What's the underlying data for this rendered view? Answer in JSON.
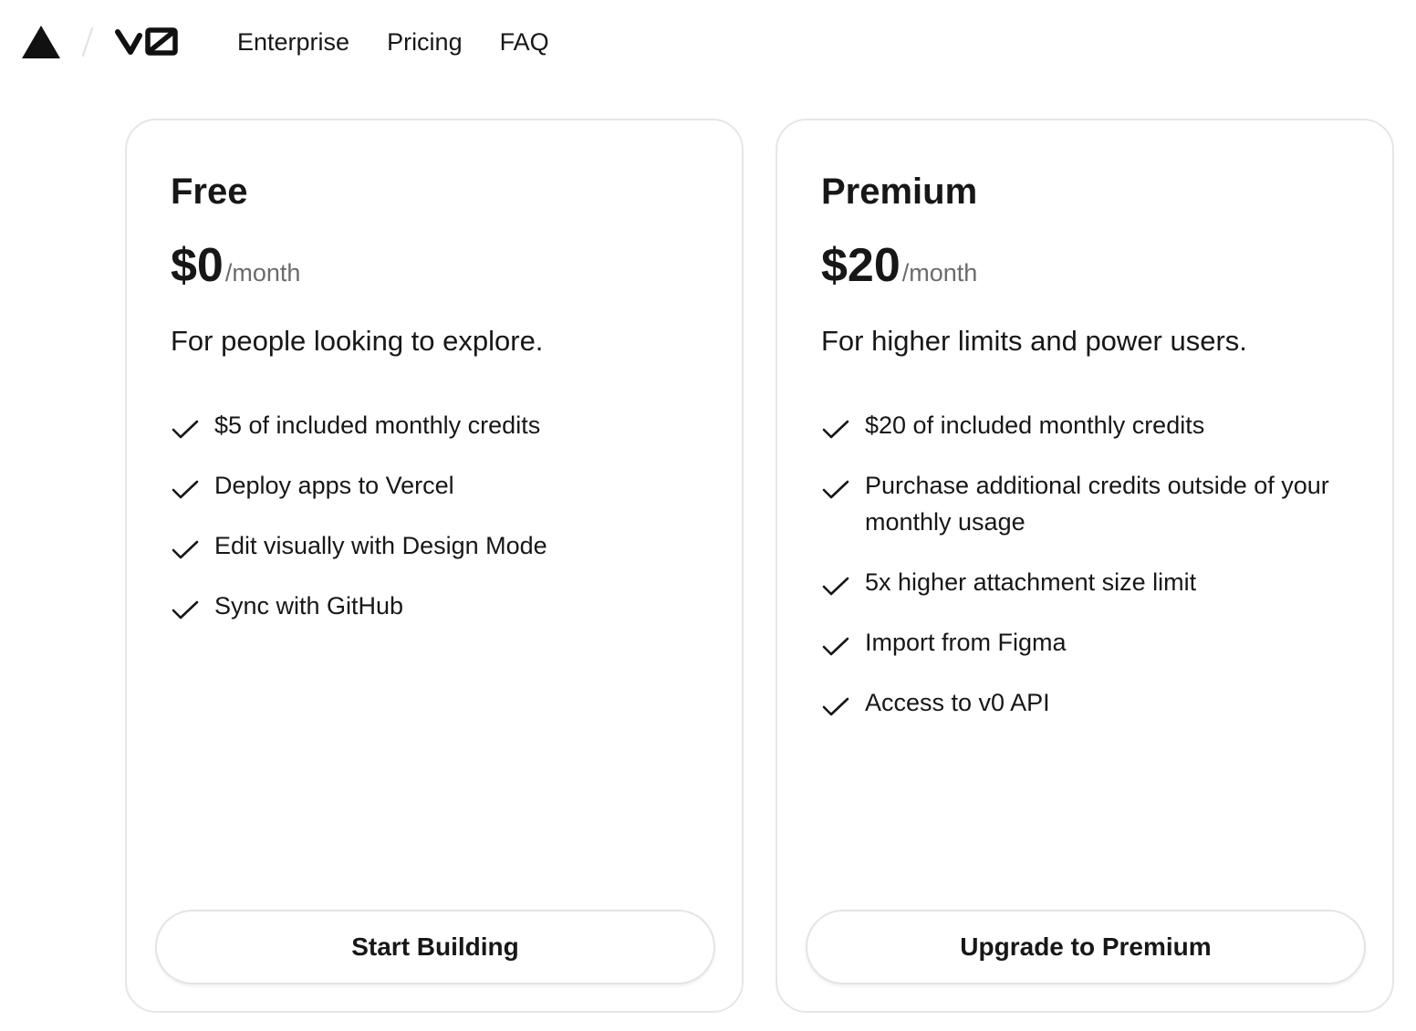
{
  "nav": {
    "logo_icon": "vercel-triangle-icon",
    "separator_icon": "slash-separator-icon",
    "product_logo_icon": "v0-logo-icon",
    "links": [
      {
        "label": "Enterprise"
      },
      {
        "label": "Pricing"
      },
      {
        "label": "FAQ"
      }
    ]
  },
  "plans": [
    {
      "name": "Free",
      "price": "$0",
      "period": "/month",
      "description": "For people looking to explore.",
      "features": [
        "$5 of included monthly credits",
        "Deploy apps to Vercel",
        "Edit visually with Design Mode",
        "Sync with GitHub"
      ],
      "cta_label": "Start Building"
    },
    {
      "name": "Premium",
      "price": "$20",
      "period": "/month",
      "description": "For higher limits and power users.",
      "features": [
        "$20 of included monthly credits",
        "Purchase additional credits outside of your monthly usage",
        "5x higher attachment size limit",
        "Import from Figma",
        "Access to v0 API"
      ],
      "cta_label": "Upgrade to Premium"
    }
  ],
  "colors": {
    "text": "#171717",
    "muted": "#6b6b6b",
    "border": "#e6e6e6",
    "background": "#ffffff"
  },
  "icons": {
    "feature_check": "check-icon"
  }
}
